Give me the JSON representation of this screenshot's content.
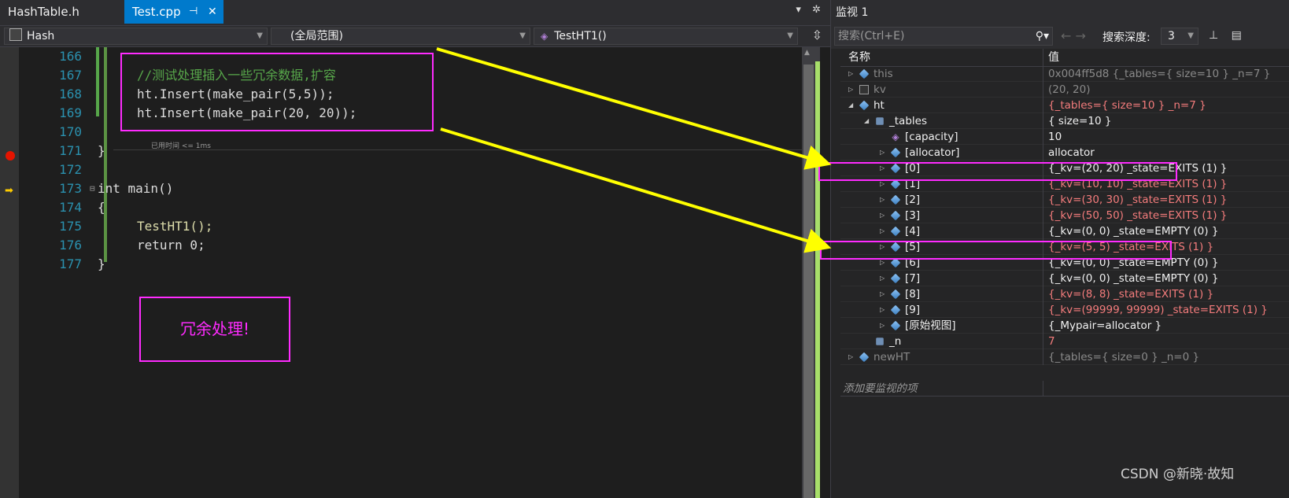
{
  "tabs": [
    {
      "label": "HashTable.h",
      "active": false
    },
    {
      "label": "Test.cpp",
      "active": true
    }
  ],
  "tab_pin": "⊣",
  "tab_close": "✕",
  "nav": {
    "project": "Hash",
    "scope": "(全局范围)",
    "function": "TestHT1()"
  },
  "code_lines": [
    {
      "num": "166",
      "text": ""
    },
    {
      "num": "167",
      "text": "//测试处理插入一些冗余数据,扩容"
    },
    {
      "num": "168",
      "text": "ht.Insert(make_pair(5,5));"
    },
    {
      "num": "169",
      "text": "ht.Insert(make_pair(20, 20));"
    },
    {
      "num": "170",
      "text": ""
    },
    {
      "num": "171",
      "text": "}"
    },
    {
      "num": "172",
      "text": ""
    },
    {
      "num": "173",
      "text": "int main()"
    },
    {
      "num": "174",
      "text": "{"
    },
    {
      "num": "175",
      "text": "TestHT1();"
    },
    {
      "num": "176",
      "text": "return 0;"
    },
    {
      "num": "177",
      "text": "}"
    }
  ],
  "elapsed": "已用时间 <= 1ms",
  "annotation_note": "冗余处理!",
  "watch": {
    "title": "监视 1",
    "search_placeholder": "搜索(Ctrl+E)",
    "depth_label": "搜索深度:",
    "depth_value": "3",
    "col_name": "名称",
    "col_value": "值",
    "add_item": "添加要监视的项",
    "rows": [
      {
        "name": "this",
        "value": "0x004ff5d8 {_tables={ size=10 } _n=7 }",
        "indent": 0,
        "exp": "▷",
        "style": "grey"
      },
      {
        "name": "kv",
        "value": "(20, 20)",
        "indent": 0,
        "exp": "▷",
        "style": "grey"
      },
      {
        "name": "ht",
        "value": "{_tables={ size=10 } _n=7 }",
        "indent": 0,
        "exp": "◢",
        "style": "red"
      },
      {
        "name": "_tables",
        "value": "{ size=10 }",
        "indent": 1,
        "exp": "◢",
        "style": "normal"
      },
      {
        "name": "[capacity]",
        "value": "10",
        "indent": 2,
        "exp": "",
        "style": "normal"
      },
      {
        "name": "[allocator]",
        "value": "allocator",
        "indent": 2,
        "exp": "▷",
        "style": "normal"
      },
      {
        "name": "[0]",
        "value": "{_kv=(20, 20) _state=EXITS (1) }",
        "indent": 2,
        "exp": "▷",
        "style": "normal"
      },
      {
        "name": "[1]",
        "value": "{_kv=(10, 10) _state=EXITS (1) }",
        "indent": 2,
        "exp": "▷",
        "style": "red"
      },
      {
        "name": "[2]",
        "value": "{_kv=(30, 30) _state=EXITS (1) }",
        "indent": 2,
        "exp": "▷",
        "style": "red"
      },
      {
        "name": "[3]",
        "value": "{_kv=(50, 50) _state=EXITS (1) }",
        "indent": 2,
        "exp": "▷",
        "style": "red"
      },
      {
        "name": "[4]",
        "value": "{_kv=(0, 0) _state=EMPTY (0) }",
        "indent": 2,
        "exp": "▷",
        "style": "normal"
      },
      {
        "name": "[5]",
        "value": "{_kv=(5, 5) _state=EXITS (1) }",
        "indent": 2,
        "exp": "▷",
        "style": "red"
      },
      {
        "name": "[6]",
        "value": "{_kv=(0, 0) _state=EMPTY (0) }",
        "indent": 2,
        "exp": "▷",
        "style": "normal"
      },
      {
        "name": "[7]",
        "value": "{_kv=(0, 0) _state=EMPTY (0) }",
        "indent": 2,
        "exp": "▷",
        "style": "normal"
      },
      {
        "name": "[8]",
        "value": "{_kv=(8, 8) _state=EXITS (1) }",
        "indent": 2,
        "exp": "▷",
        "style": "red"
      },
      {
        "name": "[9]",
        "value": "{_kv=(99999, 99999) _state=EXITS (1) }",
        "indent": 2,
        "exp": "▷",
        "style": "red"
      },
      {
        "name": "[原始视图]",
        "value": "{_Mypair=allocator }",
        "indent": 2,
        "exp": "▷",
        "style": "normal"
      },
      {
        "name": "_n",
        "value": "7",
        "indent": 1,
        "exp": "",
        "style": "red"
      },
      {
        "name": "newHT",
        "value": "{_tables={ size=0 } _n=0 }",
        "indent": 0,
        "exp": "▷",
        "style": "grey"
      }
    ]
  },
  "watermark": "CSDN @新晓·故知",
  "colors": {
    "accent": "#007acc",
    "annotation": "#ff2bff",
    "arrow": "#ffff00",
    "changed_value": "#f47c7c"
  }
}
